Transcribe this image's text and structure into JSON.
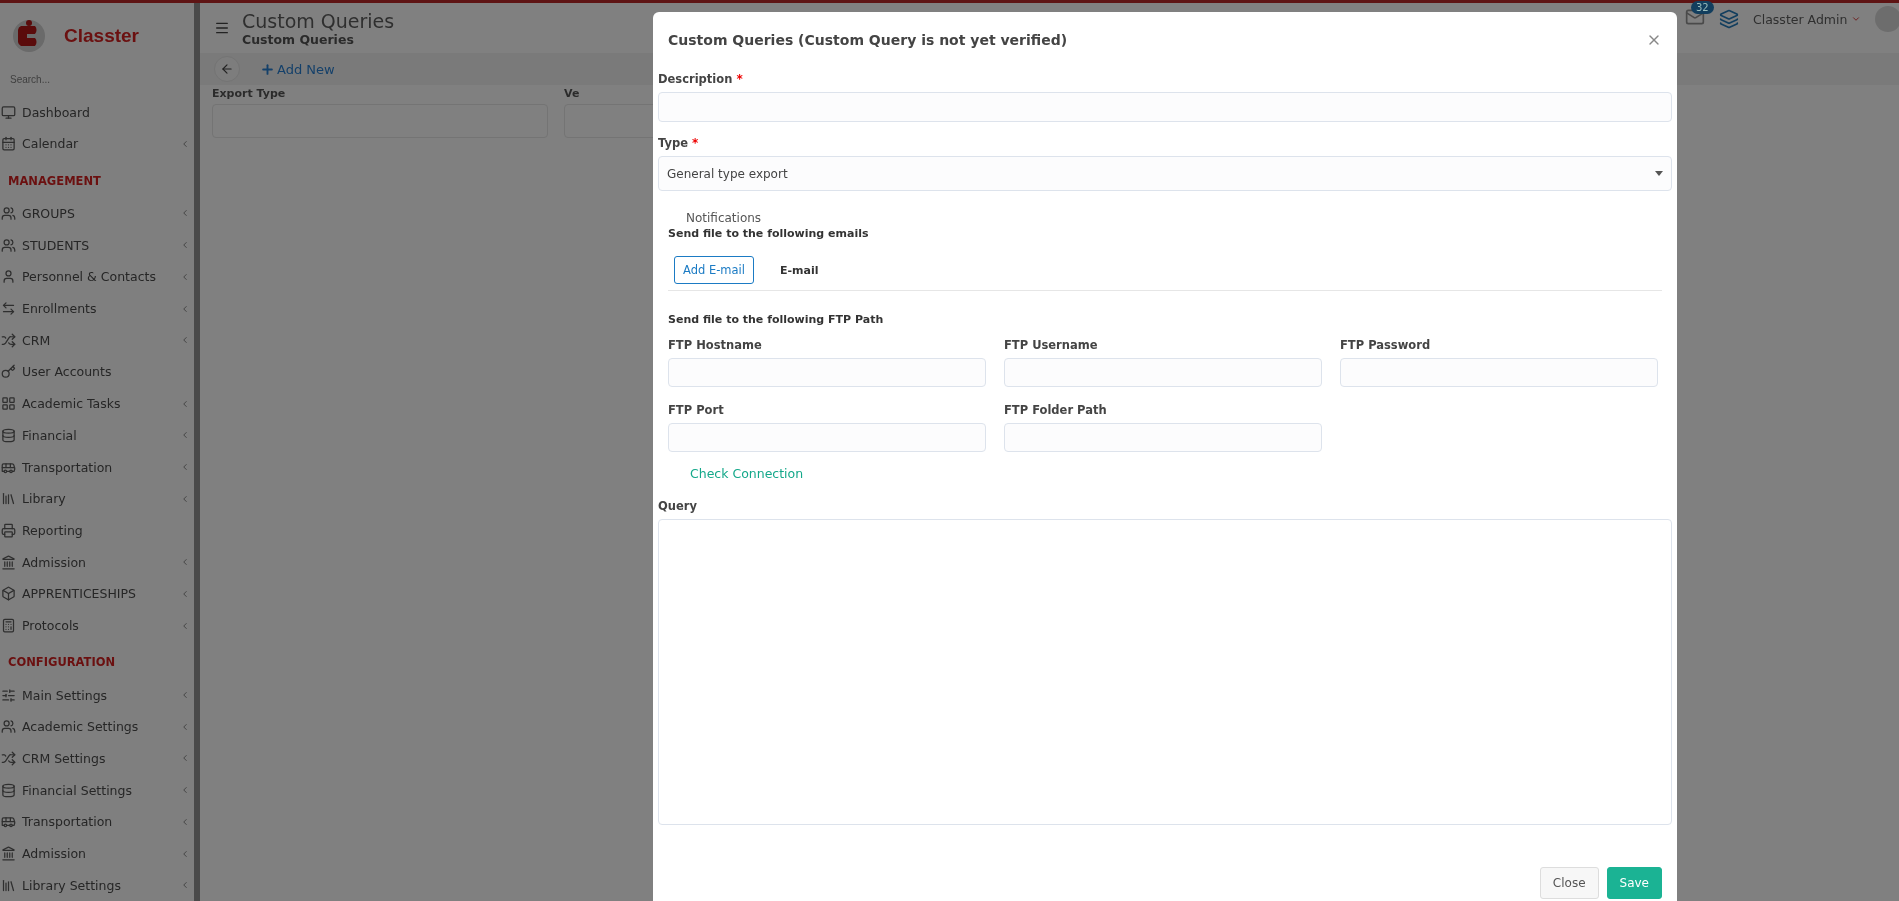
{
  "sidebar": {
    "logo": "Classter",
    "search": {
      "placeholder": "Search..."
    },
    "items": [
      {
        "kind": "item",
        "label": "Dashboard",
        "expandable": false
      },
      {
        "kind": "item",
        "label": "Calendar",
        "expandable": true
      },
      {
        "kind": "section",
        "label": "MANAGEMENT"
      },
      {
        "kind": "item",
        "label": "GROUPS",
        "expandable": true
      },
      {
        "kind": "item",
        "label": "STUDENTS",
        "expandable": true
      },
      {
        "kind": "item",
        "label": "Personnel & Contacts",
        "expandable": true
      },
      {
        "kind": "item",
        "label": "Enrollments",
        "expandable": true
      },
      {
        "kind": "item",
        "label": "CRM",
        "expandable": true
      },
      {
        "kind": "item",
        "label": "User Accounts",
        "expandable": false
      },
      {
        "kind": "item",
        "label": "Academic Tasks",
        "expandable": true
      },
      {
        "kind": "item",
        "label": "Financial",
        "expandable": true
      },
      {
        "kind": "item",
        "label": "Transportation",
        "expandable": true
      },
      {
        "kind": "item",
        "label": "Library",
        "expandable": true
      },
      {
        "kind": "item",
        "label": "Reporting",
        "expandable": false
      },
      {
        "kind": "item",
        "label": "Admission",
        "expandable": true
      },
      {
        "kind": "item",
        "label": "APPRENTICESHIPS",
        "expandable": true
      },
      {
        "kind": "item",
        "label": "Protocols",
        "expandable": true
      },
      {
        "kind": "section",
        "label": "CONFIGURATION"
      },
      {
        "kind": "item",
        "label": "Main Settings",
        "expandable": true
      },
      {
        "kind": "item",
        "label": "Academic Settings",
        "expandable": true
      },
      {
        "kind": "item",
        "label": "CRM Settings",
        "expandable": true
      },
      {
        "kind": "item",
        "label": "Financial Settings",
        "expandable": true
      },
      {
        "kind": "item",
        "label": "Transportation",
        "expandable": true
      },
      {
        "kind": "item",
        "label": "Admission",
        "expandable": true
      },
      {
        "kind": "item",
        "label": "Library Settings",
        "expandable": true
      }
    ]
  },
  "header": {
    "title": "Custom Queries",
    "subtitle": "Custom Queries",
    "mail_badge": "32",
    "user": "Classter Admin"
  },
  "toolbar": {
    "add_button": "Add New"
  },
  "filters": [
    {
      "label": "Export Type"
    },
    {
      "label": "Ve"
    }
  ],
  "modal": {
    "title": "Custom Queries (Custom Query is not yet verified)",
    "description": {
      "label": "Description",
      "required_mark": "*"
    },
    "type": {
      "label": "Type",
      "required_mark": "*",
      "value": "General type export"
    },
    "notifications": {
      "heading": "Notifications",
      "subheading": "Send file to the following emails",
      "add_button": "Add E-mail",
      "column": "E-mail"
    },
    "ftp": {
      "heading": "Send file to the following FTP Path",
      "fields": [
        {
          "label": "FTP Hostname"
        },
        {
          "label": "FTP Username"
        },
        {
          "label": "FTP Password"
        },
        {
          "label": "FTP Port"
        },
        {
          "label": "FTP Folder Path"
        }
      ],
      "check_link": "Check Connection"
    },
    "query": {
      "label": "Query"
    },
    "buttons": [
      {
        "kind": "secondary",
        "label": "Close"
      },
      {
        "kind": "primary",
        "label": "Save"
      }
    ]
  }
}
